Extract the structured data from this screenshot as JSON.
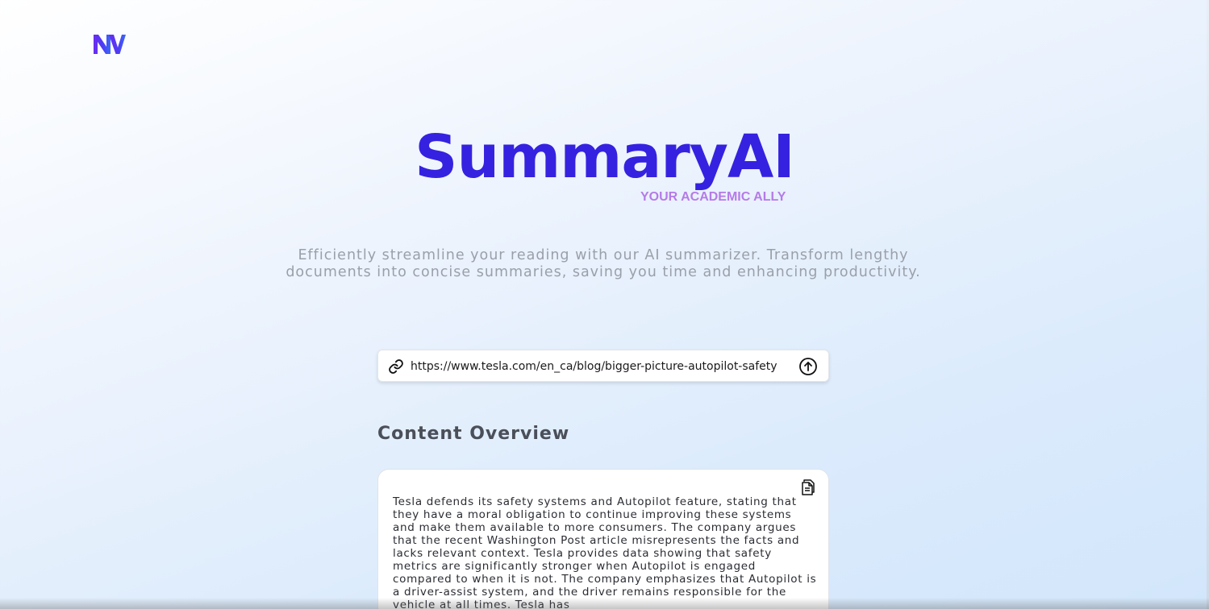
{
  "logo": {
    "text": "NV",
    "icon": "nv-logo-icon"
  },
  "brand": {
    "title": "SummaryAI",
    "tagline": "YOUR ACADEMIC ALLY",
    "title_color": "#3522e0",
    "tagline_color": "#b57be8"
  },
  "description": "Efficiently streamline your reading with our AI summarizer. Transform lengthy documents into concise summaries, saving you time and enhancing productivity.",
  "url_form": {
    "value": "https://www.tesla.com/en_ca/blog/bigger-picture-autopilot-safety",
    "link_icon": "link-icon",
    "submit_icon": "arrow-up-circle-icon"
  },
  "content_overview": {
    "title": "Content Overview",
    "copy_icon": "copy-icon",
    "summary": "Tesla defends its safety systems and Autopilot feature, stating that they have a moral obligation to continue improving these systems and make them available to more consumers. The company argues that the recent Washington Post article misrepresents the facts and lacks relevant context. Tesla provides data showing that safety metrics are significantly stronger when Autopilot is engaged compared to when it is not. The company emphasizes that Autopilot is a driver-assist system, and the driver remains responsible for the vehicle at all times. Tesla has"
  }
}
